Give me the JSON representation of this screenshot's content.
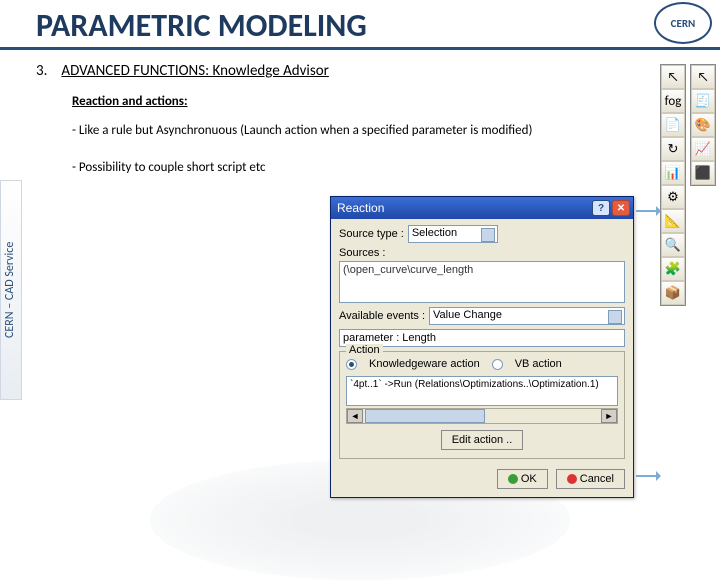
{
  "header": {
    "title": "PARAMETRIC MODELING",
    "logo_text": "CERN"
  },
  "side_label": "CERN – CAD Service",
  "content": {
    "number": "3.",
    "section_title": "ADVANCED FUNCTIONS: Knowledge Advisor",
    "subhead": "Reaction and actions:",
    "bullet1": "- Like a rule but Asynchronuous (Launch action when a specified parameter is modified)",
    "bullet2": "- Possibility to couple short script etc"
  },
  "dialog": {
    "title": "Reaction",
    "source_type_label": "Source type :",
    "source_type_value": "Selection",
    "sources_label": "Sources :",
    "sources_value": "(\\open_curve\\curve_length",
    "available_events_label": "Available events :",
    "available_events_value": "Value Change",
    "parameter_field": "parameter : Length",
    "action_group": "Action",
    "radio_kw": "Knowledgeware action",
    "radio_vb": "VB action",
    "script_text": "`4pt..1` ->Run (Relations\\Optimizations..\\Optimization.1)",
    "edit_action": "Edit action ..",
    "ok": "OK",
    "cancel": "Cancel"
  },
  "toolbar_a": [
    "↖",
    "fog",
    "📄",
    "↻",
    "📊",
    "⚙",
    "📐",
    "🔍",
    "🧩",
    "📦"
  ],
  "toolbar_b": [
    "↖",
    "🧾",
    "🎨",
    "📈",
    "⬛"
  ]
}
